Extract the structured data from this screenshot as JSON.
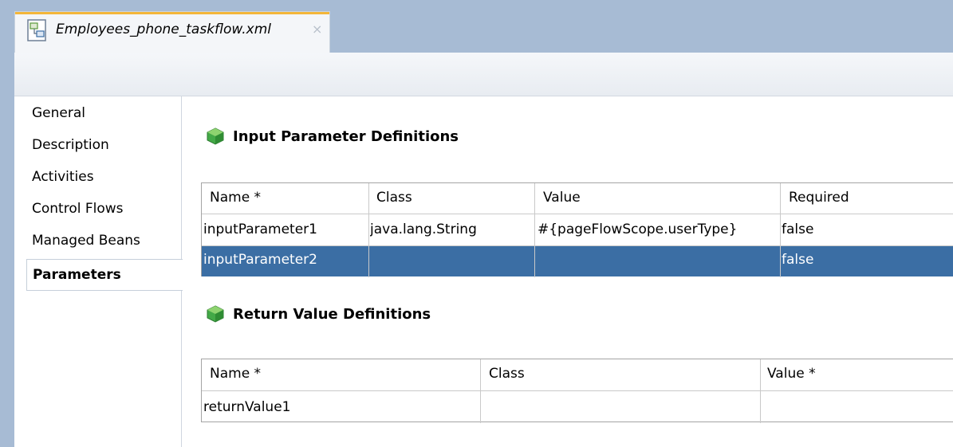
{
  "window": {
    "tab_title": "Employees_phone_taskflow.xml",
    "close_glyph": "×"
  },
  "nav": {
    "items": [
      "General",
      "Description",
      "Activities",
      "Control Flows",
      "Managed Beans"
    ],
    "active": "Parameters"
  },
  "input_section": {
    "title": "Input Parameter Definitions",
    "columns": [
      "Name *",
      "Class",
      "Value",
      "Required"
    ],
    "rows": [
      [
        "inputParameter1",
        "java.lang.String",
        "#{pageFlowScope.userType}",
        "false"
      ],
      [
        "inputParameter2",
        "",
        "",
        "false"
      ]
    ],
    "selected_row": 1
  },
  "return_section": {
    "title": "Return Value Definitions",
    "columns": [
      "Name *",
      "Class",
      "Value *"
    ],
    "rows": [
      [
        "returnValue1",
        "",
        ""
      ]
    ]
  },
  "colors": {
    "selection": "#3b6ea4",
    "tabbar": "#a7bbd4",
    "tab_accent": "#f3b63a"
  }
}
